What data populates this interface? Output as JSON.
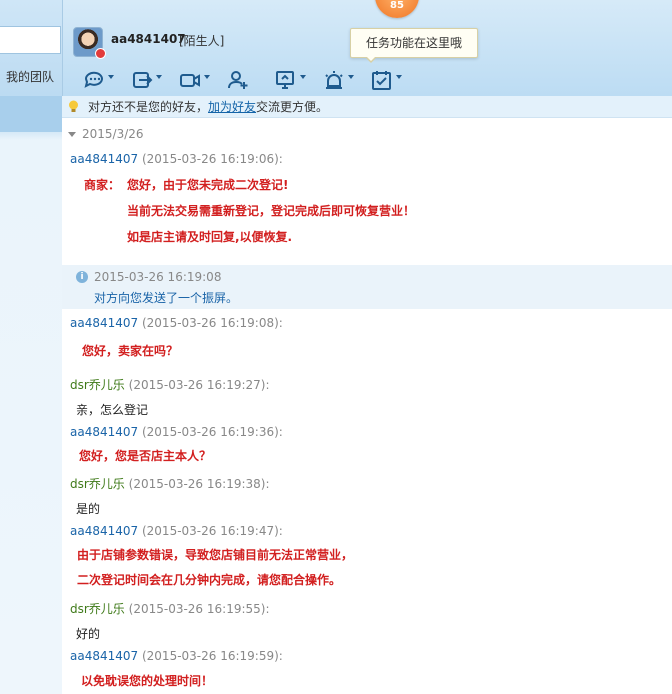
{
  "sidebar": {
    "team_label": "我的团队"
  },
  "header": {
    "username": "aa4841407",
    "relation": "[陌生人]",
    "badge_count": "85",
    "tooltip": "任务功能在这里哦",
    "toolbar_icons": [
      "chat-bubble-icon",
      "file-transfer-icon",
      "video-call-icon",
      "add-contact-icon",
      "screen-share-icon",
      "remote-assist-icon",
      "task-calendar-icon"
    ]
  },
  "notice": {
    "prefix": "对方还不是您的好友，",
    "link": "加为好友",
    "suffix": "交流更方便。"
  },
  "chat": {
    "date": "2015/3/26",
    "messages": [
      {
        "sender": "aa4841407",
        "time": "(2015-03-26 16:19:06):"
      },
      {
        "sender": "aa4841407",
        "time": "(2015-03-26 16:19:08):",
        "text": "您好，卖家在吗？"
      },
      {
        "sender": "dsr乔儿乐",
        "time": "(2015-03-26 16:19:27):",
        "text": "亲，怎么登记"
      },
      {
        "sender": "aa4841407",
        "time": "(2015-03-26 16:19:36):",
        "text": "您好，您是否店主本人？"
      },
      {
        "sender": "dsr乔儿乐",
        "time": "(2015-03-26 16:19:38):",
        "text": "是的"
      },
      {
        "sender": "aa4841407",
        "time": "(2015-03-26 16:19:47):",
        "line1": "由于店铺参数错误，导致您店铺目前无法正常营业，",
        "line2": "二次登记时间会在几分钟内完成，请您配合操作。"
      },
      {
        "sender": "dsr乔儿乐",
        "time": "(2015-03-26 16:19:55):",
        "text": "好的"
      },
      {
        "sender": "aa4841407",
        "time": "(2015-03-26 16:19:59):",
        "text": "以免耽误您的处理时间！"
      }
    ],
    "merchant_card": {
      "label": "商家：",
      "line1": "您好，由于您未完成二次登记!",
      "line2": "当前无法交易需重新登记，登记完成后即可恢复营业！",
      "line3": "如是店主请及时回复,以便恢复."
    },
    "system": {
      "time": "2015-03-26 16:19:08",
      "text": "对方向您发送了一个振屏。"
    }
  },
  "colors": {
    "link_blue": "#1a64a8",
    "alert_red": "#d21f1f",
    "sender_green": "#3f7a19"
  }
}
